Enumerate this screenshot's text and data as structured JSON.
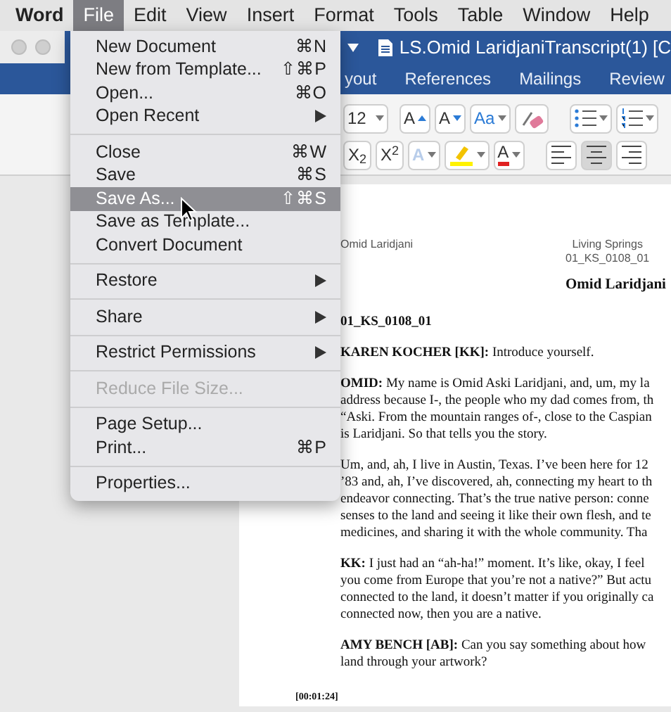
{
  "menubar": [
    {
      "label": "Word",
      "kind": "app",
      "selected": false
    },
    {
      "label": "File",
      "kind": "menu",
      "selected": true
    },
    {
      "label": "Edit",
      "kind": "menu",
      "selected": false
    },
    {
      "label": "View",
      "kind": "menu",
      "selected": false
    },
    {
      "label": "Insert",
      "kind": "menu",
      "selected": false
    },
    {
      "label": "Format",
      "kind": "menu",
      "selected": false
    },
    {
      "label": "Tools",
      "kind": "menu",
      "selected": false
    },
    {
      "label": "Table",
      "kind": "menu",
      "selected": false
    },
    {
      "label": "Window",
      "kind": "menu",
      "selected": false
    },
    {
      "label": "Help",
      "kind": "menu",
      "selected": false
    }
  ],
  "title_bar": {
    "title": "LS.Omid LaridjaniTranscript(1) [C"
  },
  "ribbon_tabs": [
    {
      "label": "yout",
      "selected": false
    },
    {
      "label": "References",
      "selected": false
    },
    {
      "label": "Mailings",
      "selected": false
    },
    {
      "label": "Review",
      "selected": false
    }
  ],
  "toolbar": [
    [
      {
        "kind": "size",
        "text": "12",
        "menu": true,
        "selected": false
      },
      {
        "kind": "grow",
        "text": "A",
        "menu": false,
        "selected": false
      },
      {
        "kind": "shrink",
        "text": "A",
        "menu": false,
        "selected": false
      },
      {
        "kind": "case",
        "text": "Aa",
        "menu": true,
        "selected": false
      },
      {
        "kind": "clear",
        "menu": false,
        "selected": false
      },
      {
        "kind": "bullets",
        "menu": true,
        "selected": false
      },
      {
        "kind": "numbering",
        "menu": true,
        "selected": false
      }
    ],
    [
      {
        "kind": "script",
        "text": "X$_{2}$",
        "menu": false,
        "selected": false
      },
      {
        "kind": "script",
        "text": "X$^{2}$",
        "menu": false,
        "selected": false
      },
      {
        "kind": "effects",
        "text": "A",
        "menu": true,
        "selected": false
      },
      {
        "kind": "highlight",
        "menu": true,
        "selected": false
      },
      {
        "kind": "color",
        "text": "A",
        "menu": true,
        "selected": false
      },
      {
        "kind": "align_left",
        "menu": false,
        "selected": false
      },
      {
        "kind": "align_center",
        "menu": false,
        "selected": true
      },
      {
        "kind": "align_right",
        "menu": false,
        "selected": false
      }
    ]
  ],
  "file_menu": [
    [
      {
        "label": "New Document",
        "shortcut": "⌘N",
        "submenu": false,
        "disabled": false,
        "selected": false
      },
      {
        "label": "New from Template...",
        "shortcut": "⇧⌘P",
        "submenu": false,
        "disabled": false,
        "selected": false
      },
      {
        "label": "Open...",
        "shortcut": "⌘O",
        "submenu": false,
        "disabled": false,
        "selected": false
      },
      {
        "label": "Open Recent",
        "submenu": true,
        "disabled": false,
        "selected": false
      }
    ],
    [
      {
        "label": "Close",
        "shortcut": "⌘W",
        "submenu": false,
        "disabled": false,
        "selected": false
      },
      {
        "label": "Save",
        "shortcut": "⌘S",
        "submenu": false,
        "disabled": false,
        "selected": false
      },
      {
        "label": "Save As...",
        "shortcut": "⇧⌘S",
        "submenu": false,
        "disabled": false,
        "selected": true
      },
      {
        "label": "Save as Template...",
        "submenu": false,
        "disabled": false,
        "selected": false
      },
      {
        "label": "Convert Document",
        "submenu": false,
        "disabled": false,
        "selected": false
      }
    ],
    [
      {
        "label": "Restore",
        "submenu": true,
        "disabled": false,
        "selected": false
      }
    ],
    [
      {
        "label": "Share",
        "submenu": true,
        "disabled": false,
        "selected": false
      }
    ],
    [
      {
        "label": "Restrict Permissions",
        "submenu": true,
        "disabled": false,
        "selected": false
      }
    ],
    [
      {
        "label": "Reduce File Size...",
        "submenu": false,
        "disabled": true,
        "selected": false
      }
    ],
    [
      {
        "label": "Page Setup...",
        "submenu": false,
        "disabled": false,
        "selected": false
      },
      {
        "label": "Print...",
        "shortcut": "⌘P",
        "submenu": false,
        "disabled": false,
        "selected": false
      }
    ],
    [
      {
        "label": "Properties...",
        "submenu": false,
        "disabled": false,
        "selected": false
      }
    ]
  ],
  "document": {
    "header_left": "Omid Laridjani",
    "header_right": [
      "Living Springs",
      "01_KS_0108_01"
    ],
    "title": "Omid Laridjani",
    "file_id": "01_KS_0108_01",
    "paragraphs": [
      [
        "**KAREN KOCHER [KK]:**  Introduce yourself."
      ],
      [
        "**OMID:**  My name is Omid Aski Laridjani, and, um, my la",
        "address because I-, the people who my dad comes from, th",
        "“Aski.  From the mountain ranges of-, close to the Caspian",
        "is Laridjani.  So that tells you the story."
      ],
      [
        "Um, and, ah, I live in Austin, Texas.  I’ve been here for 12",
        "’83 and, ah, I’ve discovered, ah, connecting my heart to th",
        "endeavor connecting.  That’s the true native person: conne",
        "senses to the land and seeing it like their own flesh, and te",
        "medicines, and sharing it with the whole community.  Tha"
      ],
      [
        "**KK:**  I just had an “ah-ha!” moment.  It’s like, okay, I feel",
        "you come from Europe that you’re not a native?”  But actu",
        "connected to the land, it doesn’t matter if you originally ca",
        "connected now, then you are a native."
      ],
      [
        "**AMY BENCH [AB]:**  Can you say something about how",
        "land through your artwork?"
      ]
    ],
    "timestamp": "[00:01:24]"
  }
}
